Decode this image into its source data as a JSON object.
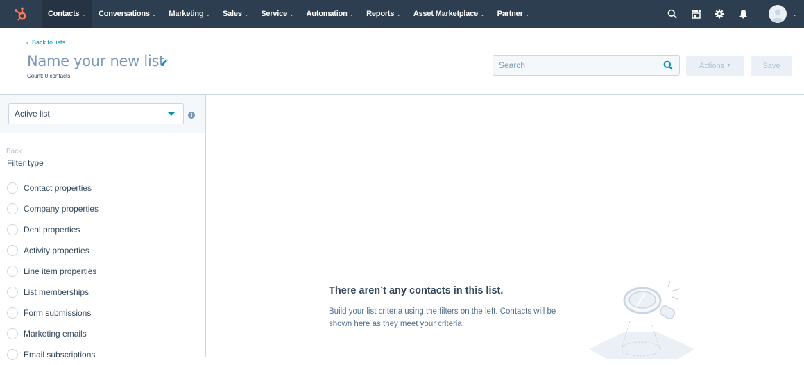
{
  "topnav": {
    "brand_color": "#ff7a59",
    "items": [
      {
        "label": "Contacts",
        "active": true
      },
      {
        "label": "Conversations",
        "active": false
      },
      {
        "label": "Marketing",
        "active": false
      },
      {
        "label": "Sales",
        "active": false
      },
      {
        "label": "Service",
        "active": false
      },
      {
        "label": "Automation",
        "active": false
      },
      {
        "label": "Reports",
        "active": false
      },
      {
        "label": "Asset Marketplace",
        "active": false
      },
      {
        "label": "Partner",
        "active": false
      }
    ],
    "right_icons": [
      "search-icon",
      "marketplace-icon",
      "settings-icon",
      "notifications-icon"
    ],
    "chevron": "⌄"
  },
  "header": {
    "back_label": "Back to lists",
    "title": "Name your new list",
    "count": "Count: 0 contacts",
    "search_placeholder": "Search",
    "search_value": "",
    "actions_label": "Actions",
    "save_label": "Save"
  },
  "sidebar": {
    "list_type": "Active list",
    "back_label": "Back",
    "filter_heading": "Filter type",
    "filters": [
      "Contact properties",
      "Company properties",
      "Deal properties",
      "Activity properties",
      "Line item properties",
      "List memberships",
      "Form submissions",
      "Marketing emails",
      "Email subscriptions"
    ]
  },
  "empty_state": {
    "title": "There aren’t any contacts in this list.",
    "description": "Build your list criteria using the filters on the left. Contacts will be shown here as they meet your criteria."
  }
}
